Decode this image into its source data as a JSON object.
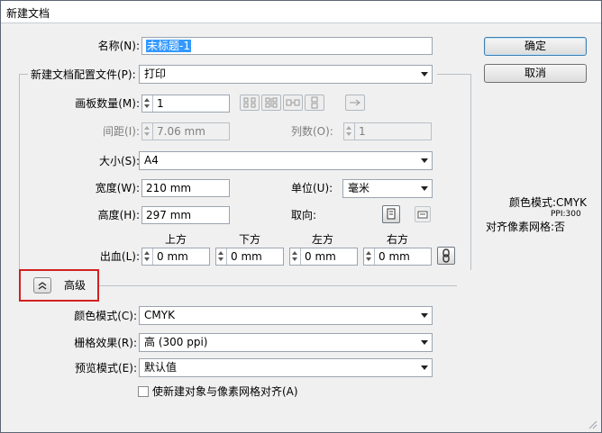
{
  "window": {
    "title": "新建文档"
  },
  "name": {
    "label": "名称(N):",
    "value": "未标题-1"
  },
  "profile": {
    "label": "新建文档配置文件(P):",
    "value": "打印"
  },
  "artboards": {
    "count_label": "画板数量(M):",
    "count_value": "1",
    "spacing_label": "间距(I):",
    "spacing_value": "7.06 mm",
    "columns_label": "列数(O):",
    "columns_value": "1"
  },
  "size": {
    "label": "大小(S):",
    "value": "A4"
  },
  "width": {
    "label": "宽度(W):",
    "value": "210 mm"
  },
  "height": {
    "label": "高度(H):",
    "value": "297 mm"
  },
  "units": {
    "label": "单位(U):",
    "value": "毫米"
  },
  "orientation": {
    "label": "取向:"
  },
  "bleed": {
    "label": "出血(L):",
    "top_label": "上方",
    "bottom_label": "下方",
    "left_label": "左方",
    "right_label": "右方",
    "top": "0 mm",
    "bottom": "0 mm",
    "left": "0 mm",
    "right": "0 mm"
  },
  "advanced": {
    "label": "高级",
    "color_mode_label": "颜色模式(C):",
    "color_mode_value": "CMYK",
    "raster_label": "栅格效果(R):",
    "raster_value": "高 (300 ppi)",
    "preview_label": "预览模式(E):",
    "preview_value": "默认值",
    "align_label": "使新建对象与像素网格对齐(A)"
  },
  "buttons": {
    "ok": "确定",
    "cancel": "取消"
  },
  "summary": {
    "color_mode": "颜色模式:CMYK",
    "ppi": "PPI:300",
    "pixel_grid": "对齐像素网格:否"
  },
  "icons": {
    "grid_by_row": "grid-by-row-icon",
    "grid_by_column": "grid-by-column-icon",
    "arrange_by_row": "arrange-by-row-icon",
    "arrange_by_column": "arrange-by-column-icon",
    "right_to_left": "right-to-left-icon",
    "portrait": "portrait-icon",
    "landscape": "landscape-icon",
    "link": "chain-link-icon",
    "collapse": "chevron-up-icon"
  },
  "colors": {
    "highlight_box": "#d22121",
    "selected_text_bg": "#3399ff"
  }
}
